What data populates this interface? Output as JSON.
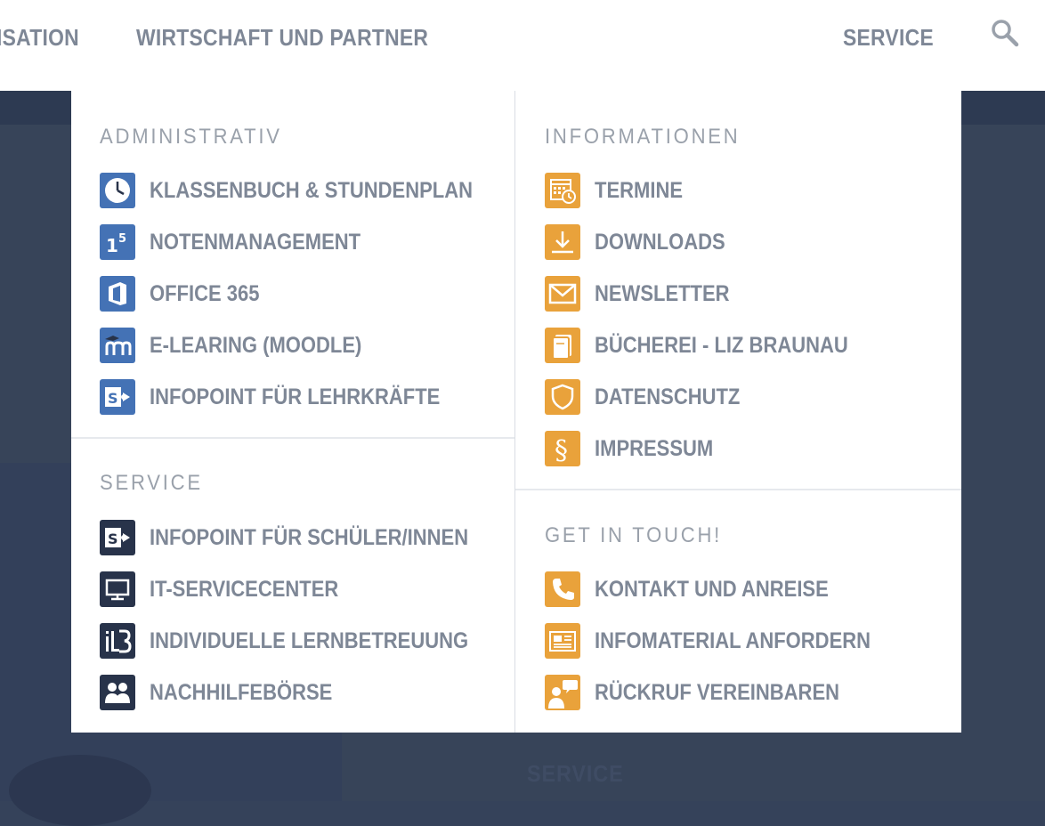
{
  "nav": {
    "item1": "ISATION",
    "item2": "WIRTSCHAFT UND PARTNER",
    "item3": "SERVICE",
    "search_icon": "search-icon"
  },
  "background": {
    "service_text": "SERVICE"
  },
  "dropdown": {
    "administrativ": {
      "title": "ADMINISTRATIV",
      "items": [
        {
          "label": "KLASSENBUCH & STUNDENPLAN",
          "icon": "clock-icon"
        },
        {
          "label": "NOTENMANAGEMENT",
          "icon": "grades-icon"
        },
        {
          "label": "OFFICE 365",
          "icon": "office-icon"
        },
        {
          "label": "E-LEARING (MOODLE)",
          "icon": "moodle-icon"
        },
        {
          "label": "INFOPOINT FÜR LEHRKRÄFTE",
          "icon": "sharepoint-icon"
        }
      ]
    },
    "service": {
      "title": "SERVICE",
      "items": [
        {
          "label": "INFOPOINT FÜR SCHÜLER/INNEN",
          "icon": "sharepoint-icon"
        },
        {
          "label": "IT-SERVICECENTER",
          "icon": "monitor-icon"
        },
        {
          "label": "INDIVIDUELLE LERNBETREUUNG",
          "icon": "ilb-icon"
        },
        {
          "label": "NACHHILFEBÖRSE",
          "icon": "people-icon"
        }
      ]
    },
    "informationen": {
      "title": "INFORMATIONEN",
      "items": [
        {
          "label": "TERMINE",
          "icon": "calendar-icon"
        },
        {
          "label": "DOWNLOADS",
          "icon": "download-icon"
        },
        {
          "label": "NEWSLETTER",
          "icon": "envelope-icon"
        },
        {
          "label": "BÜCHEREI - LIZ BRAUNAU",
          "icon": "book-icon"
        },
        {
          "label": "DATENSCHUTZ",
          "icon": "shield-icon"
        },
        {
          "label": "IMPRESSUM",
          "icon": "paragraph-icon"
        }
      ]
    },
    "get_in_touch": {
      "title": "GET IN TOUCH!",
      "items": [
        {
          "label": "KONTAKT UND ANREISE",
          "icon": "phone-icon"
        },
        {
          "label": "INFOMATERIAL ANFORDERN",
          "icon": "newspaper-icon"
        },
        {
          "label": "RÜCKRUF VEREINBAREN",
          "icon": "callback-icon"
        }
      ]
    }
  },
  "colors": {
    "accent_blue": "#4472b5",
    "accent_navy": "#28334a",
    "accent_orange": "#e9a23b",
    "text_gray": "#7e8796",
    "background_dark": "#374459"
  }
}
